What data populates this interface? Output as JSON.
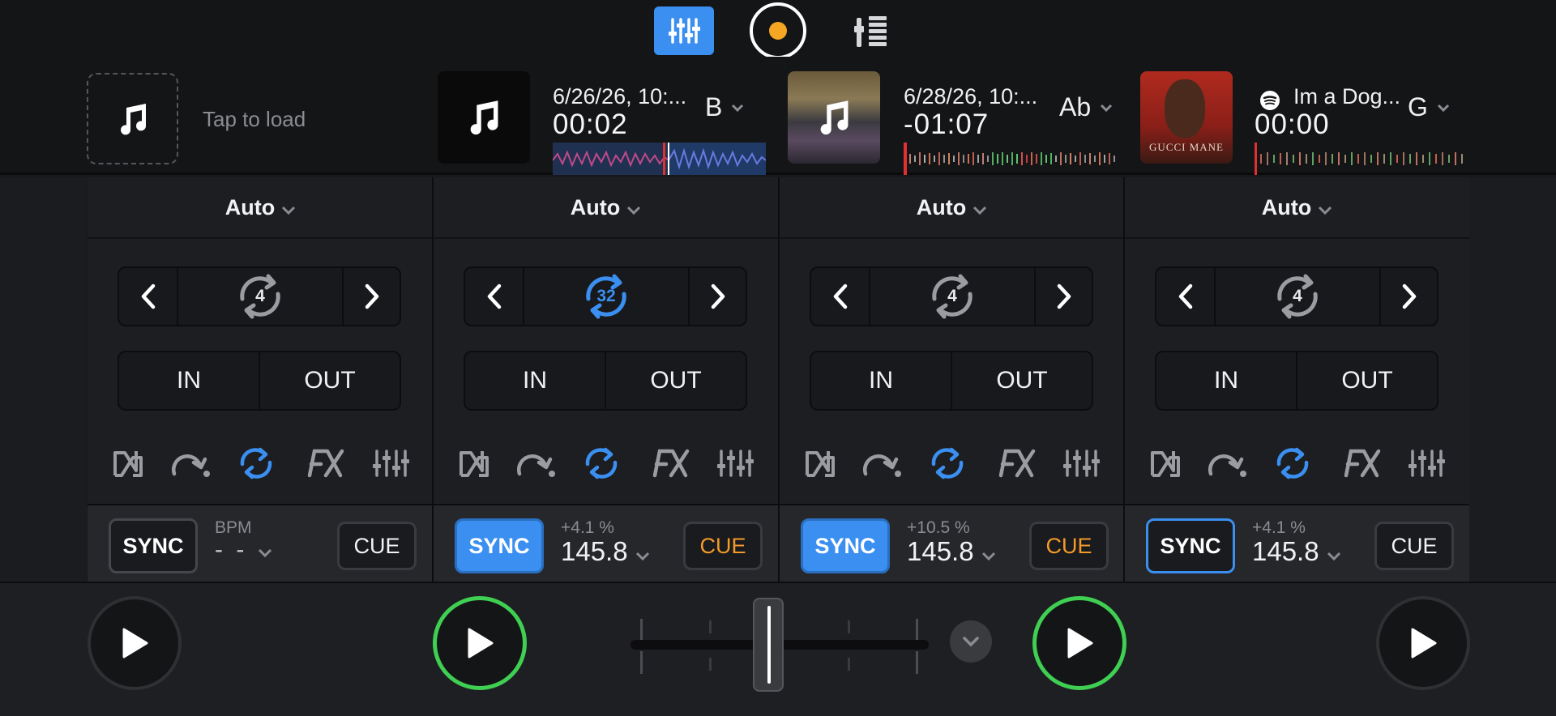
{
  "top_bar": {
    "mixer_icon": "mixer-sliders-icon",
    "record_icon": "record-icon",
    "library_icon": "library-meter-icon"
  },
  "deck_headers": {
    "empty_slot": {
      "icon": "music-note-icon",
      "label": "Tap to load"
    },
    "decks": [
      {
        "title": "6/26/26, 10:...",
        "time": "00:02",
        "key": "B"
      },
      {
        "title": "6/28/26, 10:...",
        "time": "-01:07",
        "key": "Ab"
      },
      {
        "title": "Im a Dog...",
        "time": "00:00",
        "key": "G",
        "source_icon": "spotify-icon",
        "art_text": "GUCCI MANE"
      }
    ]
  },
  "decks": [
    {
      "mode": "Auto",
      "loop_size": "4",
      "loop_active": false,
      "in_label": "IN",
      "out_label": "OUT",
      "sync_label": "SYNC",
      "sync_state": "off",
      "bpm_label": "BPM",
      "bpm": "- -",
      "pitch": "",
      "cue_label": "CUE",
      "cue_color": "white"
    },
    {
      "mode": "Auto",
      "loop_size": "32",
      "loop_active": true,
      "in_label": "IN",
      "out_label": "OUT",
      "sync_label": "SYNC",
      "sync_state": "on",
      "pitch": "+4.1 %",
      "bpm": "145.8",
      "cue_label": "CUE",
      "cue_color": "orange"
    },
    {
      "mode": "Auto",
      "loop_size": "4",
      "loop_active": false,
      "in_label": "IN",
      "out_label": "OUT",
      "sync_label": "SYNC",
      "sync_state": "on",
      "pitch": "+10.5 %",
      "bpm": "145.8",
      "cue_label": "CUE",
      "cue_color": "orange"
    },
    {
      "mode": "Auto",
      "loop_size": "4",
      "loop_active": false,
      "in_label": "IN",
      "out_label": "OUT",
      "sync_label": "SYNC",
      "sync_state": "outline",
      "pitch": "+4.1 %",
      "bpm": "145.8",
      "cue_label": "CUE",
      "cue_color": "white"
    }
  ],
  "toolbar_icons": [
    "neural-mix-icon",
    "skip-icon",
    "loop-roll-icon",
    "fx-icon",
    "eq-sliders-icon"
  ],
  "colors": {
    "accent_blue": "#3a8ff0",
    "cue_orange": "#f39a2a",
    "play_green": "#3fcf52",
    "record_orange": "#f5a623"
  },
  "transport": {
    "play_icon": "play-icon",
    "crossfader_position": 0.5,
    "expand_icon": "chevron-down-icon"
  }
}
